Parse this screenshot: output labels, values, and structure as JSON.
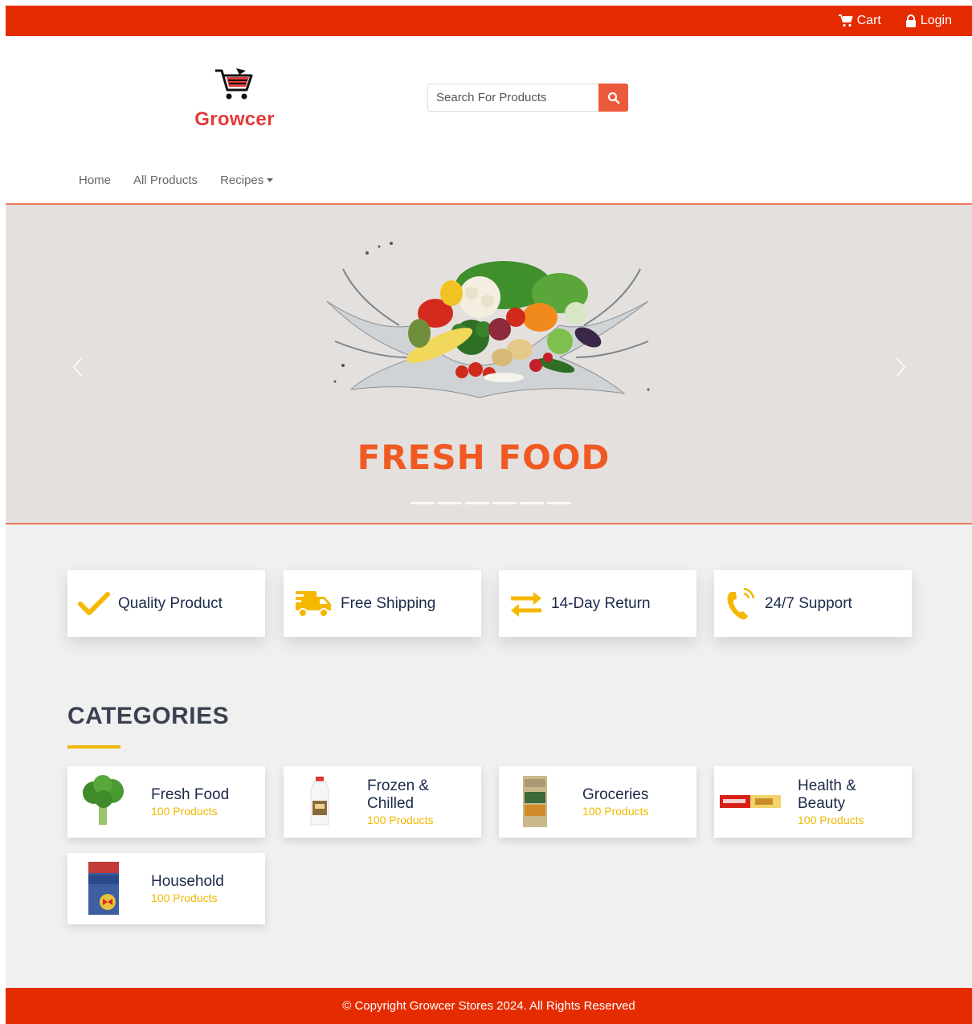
{
  "topbar": {
    "cart_label": "Cart",
    "login_label": "Login"
  },
  "logo": {
    "brand": "Growcer"
  },
  "search": {
    "placeholder": "Search For Products"
  },
  "nav": {
    "home": "Home",
    "all_products": "All Products",
    "recipes": "Recipes"
  },
  "hero": {
    "title": "FRESH FOOD",
    "slide_count": 6
  },
  "features": [
    {
      "label": "Quality Product",
      "icon": "check-icon"
    },
    {
      "label": "Free Shipping",
      "icon": "truck-icon"
    },
    {
      "label": "14-Day Return",
      "icon": "exchange-icon"
    },
    {
      "label": "24/7 Support",
      "icon": "phone-icon"
    }
  ],
  "categories_heading": "CATEGORIES",
  "categories": [
    {
      "name": "Fresh Food",
      "count": "100 Products"
    },
    {
      "name": "Frozen & Chilled",
      "count": "100 Products"
    },
    {
      "name": "Groceries",
      "count": "100 Products"
    },
    {
      "name": "Health & Beauty",
      "count": "100 Products"
    },
    {
      "name": "Household",
      "count": "100 Products"
    }
  ],
  "footer": {
    "text": "© Copyright Growcer Stores 2024. All Rights Reserved"
  },
  "colors": {
    "brand_red": "#e52c00",
    "accent_orange": "#f05a22",
    "accent_yellow": "#f0b800",
    "navy": "#1b2a4a"
  }
}
